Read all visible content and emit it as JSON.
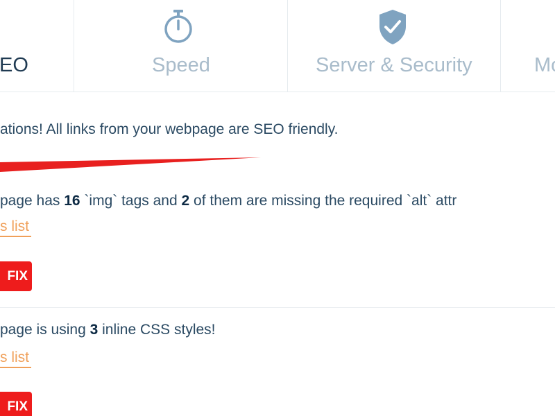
{
  "tabs": [
    {
      "label": "SEO",
      "visible_text": "EO",
      "active": true
    },
    {
      "label": "Speed",
      "icon": "stopwatch-icon",
      "active": false
    },
    {
      "label": "Server & Security",
      "icon": "shield-check-icon",
      "active": false
    },
    {
      "label": "Mo",
      "active": false
    }
  ],
  "results": {
    "links_message": "ations! All links from your webpage are SEO friendly.",
    "img_issue": {
      "prefix": "page has ",
      "count": "16",
      "middle": " `img` tags and ",
      "missing": "2",
      "suffix": " of them are missing the required `alt` attr"
    },
    "img_details_link": "s list",
    "img_fix_button": "FIX",
    "css_issue": {
      "prefix": "page is using ",
      "count": "3",
      "suffix": " inline CSS styles!"
    },
    "css_details_link": "s list",
    "css_fix_button": "FIX"
  },
  "colors": {
    "active_tab": "#1f3a52",
    "inactive_tab": "#a9bccb",
    "link": "#f0a05a",
    "fix_button": "#ee1c1c",
    "annotation_arrow": "#e8201f"
  }
}
